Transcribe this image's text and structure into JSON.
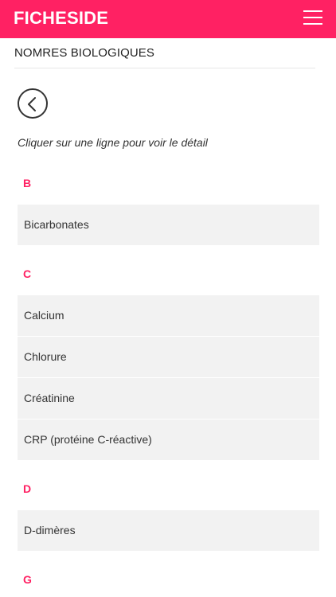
{
  "header": {
    "brand": "FICHESIDE",
    "menu_icon": "hamburger-menu-icon"
  },
  "page": {
    "title": "NOMRES BIOLOGIQUES",
    "back_icon": "chevron-left-icon",
    "hint": "Cliquer sur une ligne pour voir le détail"
  },
  "groups": [
    {
      "letter": "B",
      "items": [
        "Bicarbonates"
      ]
    },
    {
      "letter": "C",
      "items": [
        "Calcium",
        "Chlorure",
        "Créatinine",
        "CRP (protéine C-réactive)"
      ]
    },
    {
      "letter": "D",
      "items": [
        "D-dimères"
      ]
    },
    {
      "letter": "G",
      "items": []
    }
  ],
  "colors": {
    "accent": "#ff2163",
    "row_bg": "#f2f2f2"
  }
}
